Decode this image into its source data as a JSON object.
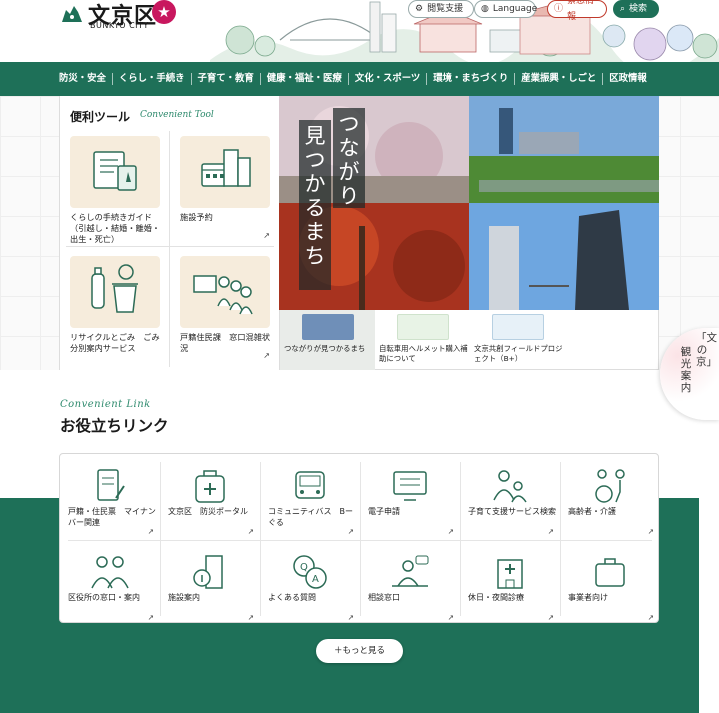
{
  "header": {
    "logo_text": "文京区",
    "logo_sub": "BUNKYO CITY",
    "logo_badge": "★",
    "reading_support": "閲覧支援",
    "language": "Language",
    "emergency": "緊急情報",
    "search": "検索"
  },
  "nav": {
    "items": [
      {
        "label": "防災・安全"
      },
      {
        "label": "くらし・手続き"
      },
      {
        "label": "子育て・教育"
      },
      {
        "label": "健康・福祉・医療"
      },
      {
        "label": "文化・スポーツ"
      },
      {
        "label": "環境・まちづくり"
      },
      {
        "label": "産業振興・しごと"
      },
      {
        "label": "区政情報"
      }
    ]
  },
  "tools": {
    "title": "便利ツール",
    "title_en": "Convenient Tool",
    "items": [
      {
        "label": "くらしの手続きガイド\n（引越し・結婚・離婚・出生・死亡）",
        "icon": "document-tablet-icon"
      },
      {
        "label": "施設予約",
        "icon": "calendar-building-icon"
      },
      {
        "label": "リサイクルとごみ　ごみ分別案内サービス",
        "icon": "recycle-bottle-icon"
      },
      {
        "label": "戸籍住民課　窓口混雑状況",
        "icon": "counter-queue-icon"
      }
    ],
    "arrow": "↗"
  },
  "hero": {
    "caption_col1": "つながり",
    "caption_col2": "見つかるまち",
    "thumbs": [
      {
        "label": "つながりが見つかるまち",
        "color": "#6f8fb8"
      },
      {
        "label": "自転車用ヘルメット購入補助について",
        "color": "#e8f3e6"
      },
      {
        "label": "文京共創フィールドプロジェクト（B+）",
        "color": "#e7f1f8"
      }
    ]
  },
  "side_tab": {
    "col1": "「文の京」",
    "col2": "観光案内"
  },
  "links": {
    "title_en": "Convenient Link",
    "title": "お役立ちリンク",
    "items": [
      {
        "label": "戸籍・住民票　マイナンバー関連",
        "icon": "document-pen-icon"
      },
      {
        "label": "文京区　防災ポータル",
        "icon": "emergency-bag-icon"
      },
      {
        "label": "コミュニティバス　Bーぐる",
        "icon": "bus-icon"
      },
      {
        "label": "電子申請",
        "icon": "computer-form-icon"
      },
      {
        "label": "子育て支援サービス検索",
        "icon": "parent-child-icon"
      },
      {
        "label": "高齢者・介護",
        "icon": "wheelchair-icon"
      },
      {
        "label": "区役所の窓口・案内",
        "icon": "staff-pair-icon"
      },
      {
        "label": "施設案内",
        "icon": "info-building-icon"
      },
      {
        "label": "よくある質問",
        "icon": "qa-bubble-icon"
      },
      {
        "label": "相談窓口",
        "icon": "consultation-icon"
      },
      {
        "label": "休日・夜間診療",
        "icon": "hospital-icon"
      },
      {
        "label": "事業者向け",
        "icon": "briefcase-icon"
      }
    ],
    "arrow": "↗",
    "more": "＋もっと見る"
  },
  "colors": {
    "brand_green": "#1e7058",
    "accent_green": "#2e8a6d",
    "emergency_red": "#c0392b",
    "tool_bg": "#f6ecdc"
  }
}
